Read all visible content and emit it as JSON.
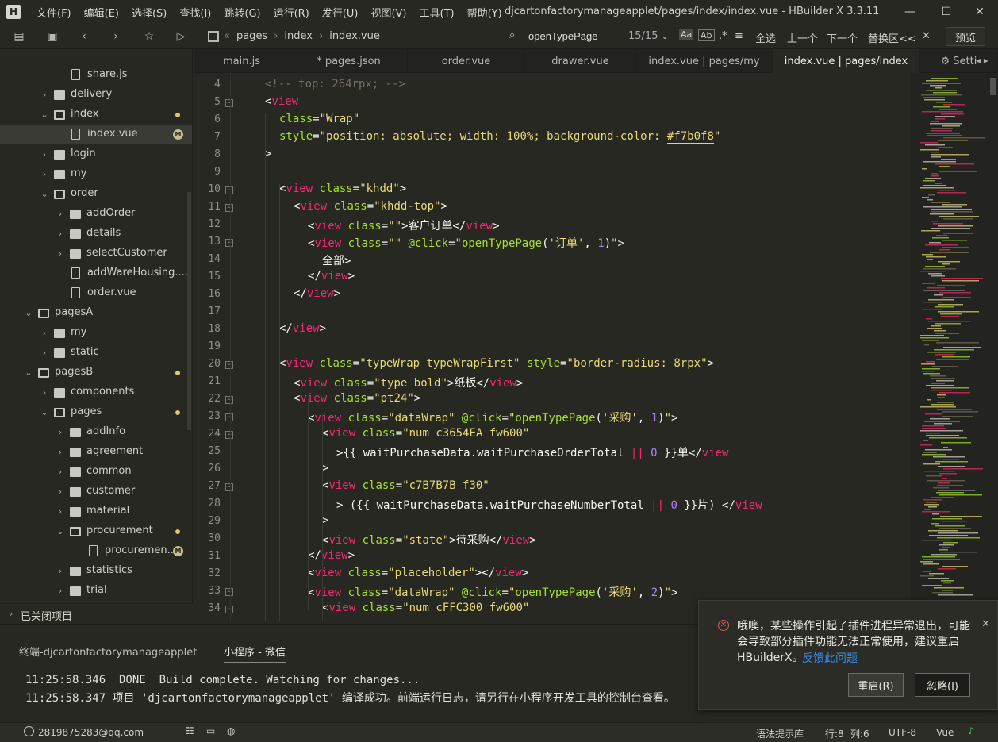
{
  "window": {
    "title": "djcartonfactorymanageapplet/pages/index/index.vue - HBuilder X 3.3.11",
    "logo_letter": "H",
    "menus": [
      "文件(F)",
      "编辑(E)",
      "选择(S)",
      "查找(I)",
      "跳转(G)",
      "运行(R)",
      "发行(U)",
      "视图(V)",
      "工具(T)",
      "帮助(Y)"
    ]
  },
  "toolbar": {
    "breadcrumb": [
      "pages",
      "index",
      "index.vue"
    ],
    "find": {
      "query": "openTypePage",
      "count": "15/15",
      "select_all": "全选",
      "prev": "上一个",
      "next": "下一个",
      "replace": "替换区<<"
    },
    "preview_label": "预览"
  },
  "sidebar": {
    "items": [
      {
        "label": "share.js",
        "kind": "file",
        "level": 4
      },
      {
        "label": "delivery",
        "kind": "folder",
        "level": 2,
        "expanded": false
      },
      {
        "label": "index",
        "kind": "folder",
        "level": 2,
        "expanded": true,
        "dot": true
      },
      {
        "label": "index.vue",
        "kind": "file",
        "level": 4,
        "selected": true,
        "badge": "M"
      },
      {
        "label": "login",
        "kind": "folder",
        "level": 2,
        "expanded": false
      },
      {
        "label": "my",
        "kind": "folder",
        "level": 2,
        "expanded": false
      },
      {
        "label": "order",
        "kind": "folder",
        "level": 2,
        "expanded": true
      },
      {
        "label": "addOrder",
        "kind": "folder",
        "level": 3,
        "expanded": false
      },
      {
        "label": "details",
        "kind": "folder",
        "level": 3,
        "expanded": false
      },
      {
        "label": "selectCustomer",
        "kind": "folder",
        "level": 3,
        "expanded": false
      },
      {
        "label": "addWareHousing....",
        "kind": "file",
        "level": 4
      },
      {
        "label": "order.vue",
        "kind": "file",
        "level": 4
      },
      {
        "label": "pagesA",
        "kind": "folder",
        "level": 1,
        "expanded": true
      },
      {
        "label": "my",
        "kind": "folder",
        "level": 2,
        "expanded": false
      },
      {
        "label": "static",
        "kind": "folder",
        "level": 2,
        "expanded": false
      },
      {
        "label": "pagesB",
        "kind": "folder",
        "level": 1,
        "expanded": true,
        "dot": true
      },
      {
        "label": "components",
        "kind": "folder",
        "level": 2,
        "expanded": false
      },
      {
        "label": "pages",
        "kind": "folder",
        "level": 2,
        "expanded": true,
        "dot": true
      },
      {
        "label": "addInfo",
        "kind": "folder",
        "level": 3,
        "expanded": false
      },
      {
        "label": "agreement",
        "kind": "folder",
        "level": 3,
        "expanded": false
      },
      {
        "label": "common",
        "kind": "folder",
        "level": 3,
        "expanded": false
      },
      {
        "label": "customer",
        "kind": "folder",
        "level": 3,
        "expanded": false
      },
      {
        "label": "material",
        "kind": "folder",
        "level": 3,
        "expanded": false
      },
      {
        "label": "procurement",
        "kind": "folder",
        "level": 3,
        "expanded": true,
        "dot": true
      },
      {
        "label": "procuremen...",
        "kind": "file",
        "level": 5,
        "badge": "M"
      },
      {
        "label": "statistics",
        "kind": "folder",
        "level": 3,
        "expanded": false
      },
      {
        "label": "trial",
        "kind": "folder",
        "level": 3,
        "expanded": false
      }
    ],
    "closed_projects_label": "已关闭项目"
  },
  "tabs": [
    {
      "label": "main.js"
    },
    {
      "label": "* pages.json"
    },
    {
      "label": "order.vue"
    },
    {
      "label": "drawer.vue"
    },
    {
      "label": "index.vue | pages/my"
    },
    {
      "label": "index.vue | pages/index",
      "active": true
    },
    {
      "label": "Setti"
    }
  ],
  "editor": {
    "lines": [
      {
        "n": "4",
        "indent": 0,
        "fold": false,
        "tokens": [
          [
            "com",
            "<!-- top: 264rpx; -->"
          ]
        ]
      },
      {
        "n": "5",
        "indent": 0,
        "fold": true,
        "tokens": [
          [
            "op",
            "<"
          ],
          [
            "tag",
            "view"
          ]
        ]
      },
      {
        "n": "6",
        "indent": 1,
        "fold": false,
        "tokens": [
          [
            "attr",
            "class"
          ],
          [
            "op",
            "="
          ],
          [
            "str",
            "\"Wrap\""
          ]
        ]
      },
      {
        "n": "7",
        "indent": 1,
        "fold": false,
        "tokens": [
          [
            "attr",
            "style"
          ],
          [
            "op",
            "="
          ],
          [
            "str",
            "\"position: absolute; width: 100%; background-color: "
          ],
          [
            "strul",
            "#f7b0f8"
          ],
          [
            "str",
            "\""
          ]
        ]
      },
      {
        "n": "8",
        "indent": 0,
        "fold": false,
        "tokens": [
          [
            "op",
            ">"
          ]
        ]
      },
      {
        "n": "9",
        "indent": 0,
        "fold": false,
        "tokens": []
      },
      {
        "n": "10",
        "indent": 1,
        "fold": true,
        "tokens": [
          [
            "op",
            "<"
          ],
          [
            "tag",
            "view"
          ],
          [
            "op",
            " "
          ],
          [
            "attr",
            "class"
          ],
          [
            "op",
            "="
          ],
          [
            "str",
            "\"khdd\""
          ],
          [
            "op",
            ">"
          ]
        ]
      },
      {
        "n": "11",
        "indent": 2,
        "fold": true,
        "tokens": [
          [
            "op",
            "<"
          ],
          [
            "tag",
            "view"
          ],
          [
            "op",
            " "
          ],
          [
            "attr",
            "class"
          ],
          [
            "op",
            "="
          ],
          [
            "str",
            "\"khdd-top\""
          ],
          [
            "op",
            ">"
          ]
        ]
      },
      {
        "n": "12",
        "indent": 3,
        "fold": false,
        "tokens": [
          [
            "op",
            "<"
          ],
          [
            "tag",
            "view"
          ],
          [
            "op",
            " "
          ],
          [
            "attr",
            "class"
          ],
          [
            "op",
            "="
          ],
          [
            "str",
            "\"\""
          ],
          [
            "op",
            ">客户订单</"
          ],
          [
            "tag",
            "view"
          ],
          [
            "op",
            ">"
          ]
        ]
      },
      {
        "n": "13",
        "indent": 3,
        "fold": true,
        "tokens": [
          [
            "op",
            "<"
          ],
          [
            "tag",
            "view"
          ],
          [
            "op",
            " "
          ],
          [
            "attr",
            "class"
          ],
          [
            "op",
            "="
          ],
          [
            "str",
            "\"\""
          ],
          [
            "op",
            " "
          ],
          [
            "attr",
            "@click"
          ],
          [
            "op",
            "="
          ],
          [
            "str",
            "\""
          ],
          [
            "fn",
            "openTypePage"
          ],
          [
            "op",
            "("
          ],
          [
            "str",
            "'订单'"
          ],
          [
            "op",
            ", "
          ],
          [
            "num",
            "1"
          ],
          [
            "op",
            ")"
          ],
          [
            "str",
            "\""
          ],
          [
            "op",
            ">"
          ]
        ]
      },
      {
        "n": "14",
        "indent": 4,
        "fold": false,
        "tokens": [
          [
            "op",
            "全部>"
          ]
        ]
      },
      {
        "n": "15",
        "indent": 3,
        "fold": false,
        "tokens": [
          [
            "op",
            "</"
          ],
          [
            "tag",
            "view"
          ],
          [
            "op",
            ">"
          ]
        ]
      },
      {
        "n": "16",
        "indent": 2,
        "fold": false,
        "tokens": [
          [
            "op",
            "</"
          ],
          [
            "tag",
            "view"
          ],
          [
            "op",
            ">"
          ]
        ]
      },
      {
        "n": "17",
        "indent": 0,
        "fold": false,
        "tokens": []
      },
      {
        "n": "18",
        "indent": 1,
        "fold": false,
        "tokens": [
          [
            "op",
            "</"
          ],
          [
            "tag",
            "view"
          ],
          [
            "op",
            ">"
          ]
        ]
      },
      {
        "n": "19",
        "indent": 0,
        "fold": false,
        "tokens": []
      },
      {
        "n": "20",
        "indent": 1,
        "fold": true,
        "tokens": [
          [
            "op",
            "<"
          ],
          [
            "tag",
            "view"
          ],
          [
            "op",
            " "
          ],
          [
            "attr",
            "class"
          ],
          [
            "op",
            "="
          ],
          [
            "str",
            "\"typeWrap typeWrapFirst\""
          ],
          [
            "op",
            " "
          ],
          [
            "attr",
            "style"
          ],
          [
            "op",
            "="
          ],
          [
            "str",
            "\"border-radius: 8rpx\""
          ],
          [
            "op",
            ">"
          ]
        ]
      },
      {
        "n": "21",
        "indent": 2,
        "fold": false,
        "tokens": [
          [
            "op",
            "<"
          ],
          [
            "tag",
            "view"
          ],
          [
            "op",
            " "
          ],
          [
            "attr",
            "class"
          ],
          [
            "op",
            "="
          ],
          [
            "str",
            "\"type bold\""
          ],
          [
            "op",
            ">纸板</"
          ],
          [
            "tag",
            "view"
          ],
          [
            "op",
            ">"
          ]
        ]
      },
      {
        "n": "22",
        "indent": 2,
        "fold": true,
        "tokens": [
          [
            "op",
            "<"
          ],
          [
            "tag",
            "view"
          ],
          [
            "op",
            " "
          ],
          [
            "attr",
            "class"
          ],
          [
            "op",
            "="
          ],
          [
            "str",
            "\"pt24\""
          ],
          [
            "op",
            ">"
          ]
        ]
      },
      {
        "n": "23",
        "indent": 3,
        "fold": true,
        "tokens": [
          [
            "op",
            "<"
          ],
          [
            "tag",
            "view"
          ],
          [
            "op",
            " "
          ],
          [
            "attr",
            "class"
          ],
          [
            "op",
            "="
          ],
          [
            "str",
            "\"dataWrap\""
          ],
          [
            "op",
            " "
          ],
          [
            "attr",
            "@click"
          ],
          [
            "op",
            "="
          ],
          [
            "str",
            "\""
          ],
          [
            "fn",
            "openTypePage"
          ],
          [
            "op",
            "("
          ],
          [
            "str",
            "'采购'"
          ],
          [
            "op",
            ", "
          ],
          [
            "num",
            "1"
          ],
          [
            "op",
            ")"
          ],
          [
            "str",
            "\""
          ],
          [
            "op",
            ">"
          ]
        ]
      },
      {
        "n": "24",
        "indent": 4,
        "fold": true,
        "tokens": [
          [
            "op",
            "<"
          ],
          [
            "tag",
            "view"
          ],
          [
            "op",
            " "
          ],
          [
            "attr",
            "class"
          ],
          [
            "op",
            "="
          ],
          [
            "str",
            "\"num c3654EA fw600\""
          ]
        ]
      },
      {
        "n": "25",
        "indent": 5,
        "fold": false,
        "tokens": [
          [
            "op",
            ">{{ waitPurchaseData.waitPurchaseOrderTotal "
          ],
          [
            "tag",
            "||"
          ],
          [
            "op",
            " "
          ],
          [
            "num",
            "0"
          ],
          [
            "op",
            " }}单</"
          ],
          [
            "tag",
            "view"
          ]
        ]
      },
      {
        "n": "26",
        "indent": 4,
        "fold": false,
        "tokens": [
          [
            "op",
            ">"
          ]
        ]
      },
      {
        "n": "27",
        "indent": 4,
        "fold": true,
        "tokens": [
          [
            "op",
            "<"
          ],
          [
            "tag",
            "view"
          ],
          [
            "op",
            " "
          ],
          [
            "attr",
            "class"
          ],
          [
            "op",
            "="
          ],
          [
            "str",
            "\"c7B7B7B f30\""
          ]
        ]
      },
      {
        "n": "28",
        "indent": 5,
        "fold": false,
        "tokens": [
          [
            "op",
            "> ({{ waitPurchaseData.waitPurchaseNumberTotal "
          ],
          [
            "tag",
            "||"
          ],
          [
            "op",
            " "
          ],
          [
            "num",
            "0"
          ],
          [
            "op",
            " }}片) </"
          ],
          [
            "tag",
            "view"
          ]
        ]
      },
      {
        "n": "29",
        "indent": 4,
        "fold": false,
        "tokens": [
          [
            "op",
            ">"
          ]
        ]
      },
      {
        "n": "30",
        "indent": 4,
        "fold": false,
        "tokens": [
          [
            "op",
            "<"
          ],
          [
            "tag",
            "view"
          ],
          [
            "op",
            " "
          ],
          [
            "attr",
            "class"
          ],
          [
            "op",
            "="
          ],
          [
            "str",
            "\"state\""
          ],
          [
            "op",
            ">待采购</"
          ],
          [
            "tag",
            "view"
          ],
          [
            "op",
            ">"
          ]
        ]
      },
      {
        "n": "31",
        "indent": 3,
        "fold": false,
        "tokens": [
          [
            "op",
            "</"
          ],
          [
            "tag",
            "view"
          ],
          [
            "op",
            ">"
          ]
        ]
      },
      {
        "n": "32",
        "indent": 3,
        "fold": false,
        "tokens": [
          [
            "op",
            "<"
          ],
          [
            "tag",
            "view"
          ],
          [
            "op",
            " "
          ],
          [
            "attr",
            "class"
          ],
          [
            "op",
            "="
          ],
          [
            "str",
            "\"placeholder\""
          ],
          [
            "op",
            "></"
          ],
          [
            "tag",
            "view"
          ],
          [
            "op",
            ">"
          ]
        ]
      },
      {
        "n": "33",
        "indent": 3,
        "fold": true,
        "tokens": [
          [
            "op",
            "<"
          ],
          [
            "tag",
            "view"
          ],
          [
            "op",
            " "
          ],
          [
            "attr",
            "class"
          ],
          [
            "op",
            "="
          ],
          [
            "str",
            "\"dataWrap\""
          ],
          [
            "op",
            " "
          ],
          [
            "attr",
            "@click"
          ],
          [
            "op",
            "="
          ],
          [
            "str",
            "\""
          ],
          [
            "fn",
            "openTypePage"
          ],
          [
            "op",
            "("
          ],
          [
            "str",
            "'采购'"
          ],
          [
            "op",
            ", "
          ],
          [
            "num",
            "2"
          ],
          [
            "op",
            ")"
          ],
          [
            "str",
            "\""
          ],
          [
            "op",
            ">"
          ]
        ]
      },
      {
        "n": "34",
        "indent": 4,
        "fold": true,
        "tokens": [
          [
            "op",
            "<"
          ],
          [
            "tag",
            "view"
          ],
          [
            "op",
            " "
          ],
          [
            "attr",
            "class"
          ],
          [
            "op",
            "="
          ],
          [
            "str",
            "\"num cFFC300 fw600\""
          ]
        ]
      }
    ]
  },
  "panel": {
    "tabs": [
      "终端-djcartonfactorymanageapplet",
      "小程序 - 微信"
    ],
    "log": [
      "11:25:58.346  DONE  Build complete. Watching for changes...",
      "11:25:58.347 项目 'djcartonfactorymanageapplet' 编译成功。前端运行日志，请另行在小程序开发工具的控制台查看。"
    ]
  },
  "statusbar": {
    "user": "2819875283@qq.com",
    "syntax_hint": "语法提示库",
    "line": "行:8",
    "col": "列:6",
    "encoding": "UTF-8",
    "language": "Vue"
  },
  "notification": {
    "message": "哦噢，某些操作引起了插件进程异常退出，可能会导致部分插件功能无法正常使用，建议重启HBuilderX。",
    "link": "反馈此问题",
    "restart_label": "重启(R)",
    "ignore_label": "忽略(I)"
  },
  "colors": {
    "background": "#272822",
    "tag": "#f92672",
    "attr": "#a6e22e",
    "string": "#e6db74",
    "comment": "#75715e",
    "number": "#ae81ff"
  }
}
